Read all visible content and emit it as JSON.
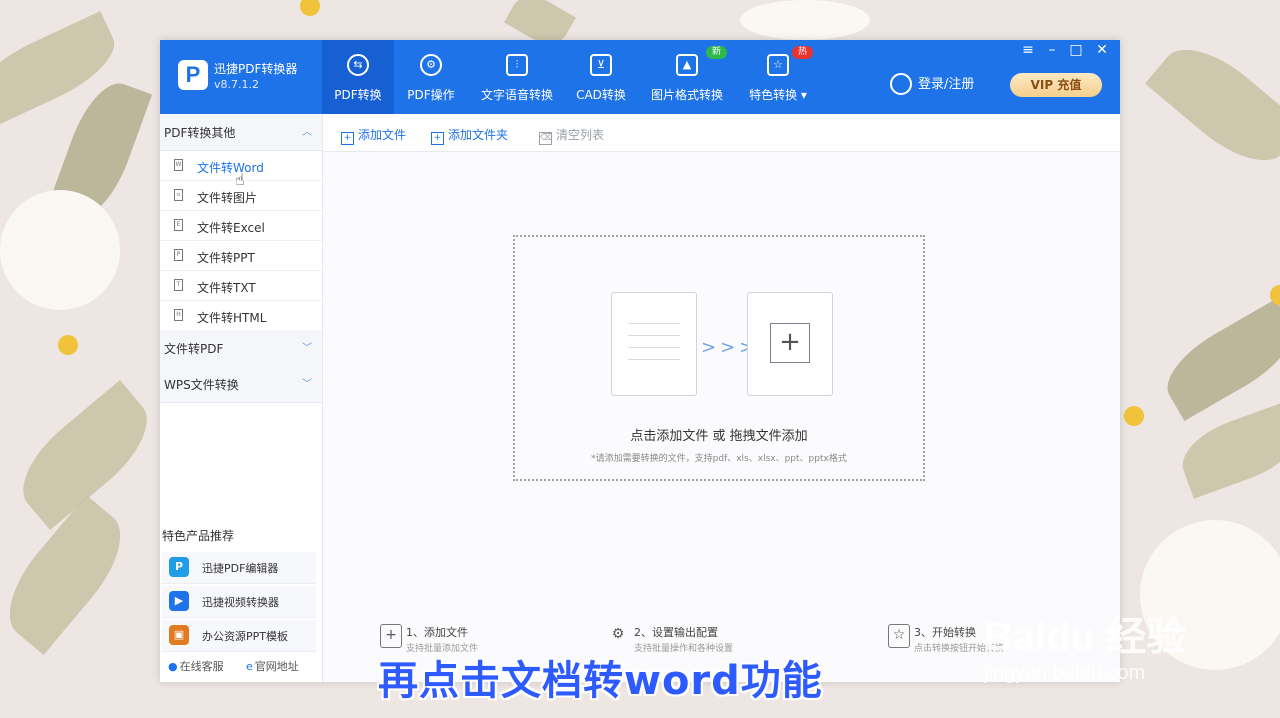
{
  "app": {
    "name": "迅捷PDF转换器",
    "version": "v8.7.1.2",
    "logo_letter": "P",
    "accent_color": "#1f73e8"
  },
  "nav_tabs": [
    {
      "label": "PDF转换",
      "icon": "convert-icon",
      "active": true
    },
    {
      "label": "PDF操作",
      "icon": "settings-icon"
    },
    {
      "label": "文字语音转换",
      "icon": "audio-wave-icon"
    },
    {
      "label": "CAD转换",
      "icon": "cad-icon"
    },
    {
      "label": "图片格式转换",
      "icon": "image-icon",
      "badge": "新"
    },
    {
      "label": "特色转换",
      "icon": "star-icon",
      "badge": "热"
    }
  ],
  "header": {
    "login_label": "登录/注册",
    "vip_label": "VIP 充值"
  },
  "sidebar": {
    "section_1": "PDF转换其他",
    "items": [
      {
        "label": "文件转Word",
        "active": true
      },
      {
        "label": "文件转图片"
      },
      {
        "label": "文件转Excel"
      },
      {
        "label": "文件转PPT"
      },
      {
        "label": "文件转TXT"
      },
      {
        "label": "文件转HTML"
      }
    ],
    "section_2": "文件转PDF",
    "section_3": "WPS文件转换",
    "rec_title": "特色产品推荐",
    "rec_items": [
      {
        "label": "迅捷PDF编辑器"
      },
      {
        "label": "迅捷视频转换器"
      },
      {
        "label": "办公资源PPT模板"
      }
    ],
    "footer_1": "在线客服",
    "footer_2": "官网地址"
  },
  "toolbar": {
    "add_file": "添加文件",
    "add_folder": "添加文件夹",
    "clear_list": "清空列表"
  },
  "dropzone": {
    "title": "点击添加文件 或 拖拽文件添加",
    "hint": "*请添加需要转换的文件，支持pdf、xls、xlsx、ppt、pptx格式"
  },
  "steps": [
    {
      "title": "1、添加文件",
      "desc": "支持批量添加文件"
    },
    {
      "title": "2、设置输出配置",
      "desc": "支持批量操作和各种设置"
    },
    {
      "title": "3、开始转换",
      "desc": "点击转换按钮开始转换"
    }
  ],
  "caption": "再点击文档转word功能",
  "watermark": {
    "brand": "Baidu 经验",
    "url": "jingyan.baidu.com"
  }
}
